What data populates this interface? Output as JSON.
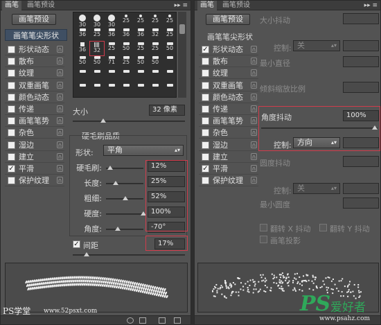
{
  "left": {
    "tabs": [
      "画笔",
      "画笔预设"
    ],
    "preset_button": "画笔预设",
    "list_head": "画笔笔尖形状",
    "categories": [
      {
        "label": "形状动态",
        "checked": false
      },
      {
        "label": "散布",
        "checked": false
      },
      {
        "label": "纹理",
        "checked": false
      },
      {
        "label": "双重画笔",
        "checked": false
      },
      {
        "label": "颜色动态",
        "checked": false
      },
      {
        "label": "传递",
        "checked": false
      },
      {
        "label": "画笔笔势",
        "checked": false
      },
      {
        "label": "杂色",
        "checked": false
      },
      {
        "label": "湿边",
        "checked": false
      },
      {
        "label": "建立",
        "checked": false
      },
      {
        "label": "平滑",
        "checked": true
      },
      {
        "label": "保护纹理",
        "checked": false
      }
    ],
    "grid_numbers": [
      [
        "30",
        "30",
        "30",
        "25",
        "25",
        "25",
        "25"
      ],
      [
        "36",
        "25",
        "36",
        "36",
        "36",
        "32",
        "25"
      ],
      [
        "36",
        "32",
        "25",
        "50",
        "25",
        "25",
        "50"
      ],
      [
        "50",
        "50",
        "71",
        "25",
        "50",
        "50",
        ""
      ],
      [
        "",
        "",
        "",
        "",
        "",
        "",
        ""
      ]
    ],
    "size_label": "大小",
    "size_value": "32 像素",
    "bristle_title": "硬毛刷品质",
    "shape_label": "形状:",
    "shape_value": "平角",
    "params": [
      {
        "label": "硬毛刷:",
        "value": "12%",
        "level": 0.12
      },
      {
        "label": "长度:",
        "value": "25%",
        "level": 0.25
      },
      {
        "label": "粗细:",
        "value": "52%",
        "level": 0.52
      },
      {
        "label": "硬度:",
        "value": "100%",
        "level": 1.0
      },
      {
        "label": "角度:",
        "value": "-70°",
        "level": 0.31
      }
    ],
    "spacing_label": "间距",
    "spacing_value": "17%",
    "spacing_checked": true
  },
  "right": {
    "tabs": [
      "画笔",
      "画笔预设"
    ],
    "preset_button": "画笔预设",
    "list_head": "画笔笔尖形状",
    "categories": [
      {
        "label": "形状动态",
        "checked": true
      },
      {
        "label": "散布",
        "checked": false
      },
      {
        "label": "纹理",
        "checked": false
      },
      {
        "label": "双重画笔",
        "checked": false
      },
      {
        "label": "颜色动态",
        "checked": false
      },
      {
        "label": "传递",
        "checked": false
      },
      {
        "label": "画笔笔势",
        "checked": false
      },
      {
        "label": "杂色",
        "checked": false
      },
      {
        "label": "湿边",
        "checked": false
      },
      {
        "label": "建立",
        "checked": false
      },
      {
        "label": "平滑",
        "checked": true
      },
      {
        "label": "保护纹理",
        "checked": false
      }
    ],
    "size_jitter": "大小抖动",
    "control_label": "控制:",
    "control_off": "关",
    "min_diameter": "最小直径",
    "tilt_scale": "倾斜缩放比例",
    "angle_jitter": "角度抖动",
    "angle_jitter_value": "100%",
    "angle_control_value": "方向",
    "roundness_jitter": "圆度抖动",
    "control_off_2": "关",
    "min_roundness": "最小圆度",
    "flip_x": "翻转 X 抖动",
    "flip_y": "翻转 Y 抖动",
    "brush_projection": "画笔投影"
  },
  "watermarks": {
    "ps_study": "PS学堂",
    "site": "www.52psxt.com",
    "ps_brand": "PS",
    "ps_brand_cn": "爱好者",
    "ps_site": "www.psahz.com"
  },
  "colors": {
    "panel": "#535353",
    "highlight": "#d23c4c",
    "selected_list": "#3f4f63"
  }
}
